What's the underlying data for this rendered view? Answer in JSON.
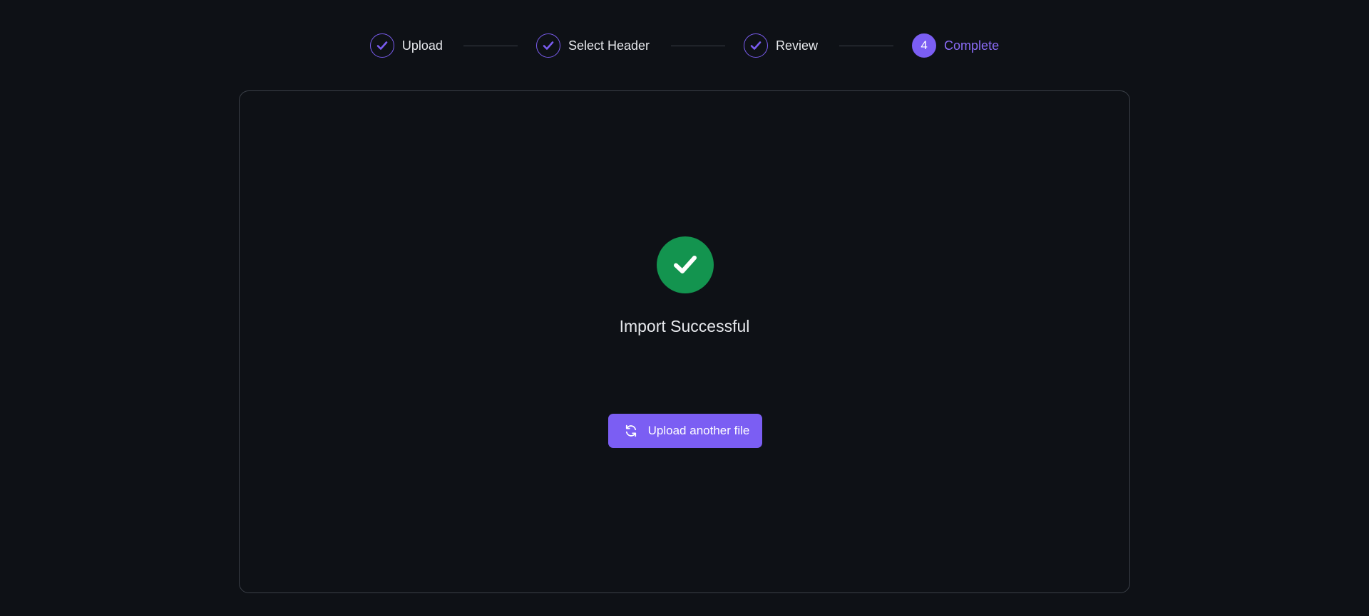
{
  "stepper": {
    "steps": [
      {
        "label": "Upload",
        "state": "completed",
        "icon": "check-icon"
      },
      {
        "label": "Select Header",
        "state": "completed",
        "icon": "check-icon"
      },
      {
        "label": "Review",
        "state": "completed",
        "icon": "check-icon"
      },
      {
        "label": "Complete",
        "state": "active",
        "number": "4"
      }
    ]
  },
  "result": {
    "icon": "check-circle-icon",
    "title": "Import Successful",
    "button_label": "Upload another file",
    "button_icon": "refresh-icon"
  },
  "colors": {
    "background": "#0e1116",
    "accent": "#7b5ef3",
    "success": "#13944f",
    "border": "#3b4048",
    "text": "#e6e8ec"
  }
}
